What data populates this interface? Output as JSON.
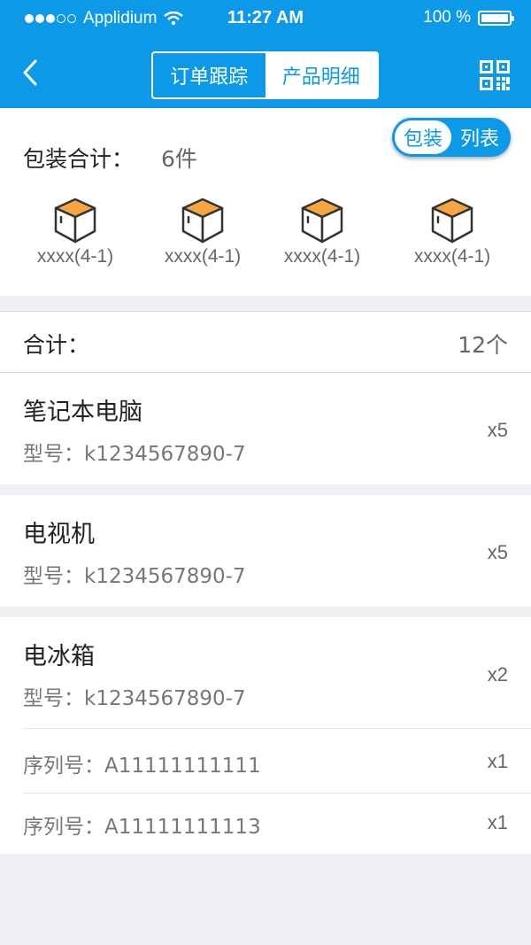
{
  "status_bar": {
    "carrier": "Applidium",
    "time": "11:27 AM",
    "battery": "100 %"
  },
  "nav": {
    "tabs": [
      {
        "label": "订单跟踪",
        "active": false
      },
      {
        "label": "产品明细",
        "active": true
      }
    ],
    "back_icon": "chevron-left-icon",
    "qr_icon": "qr-code-icon"
  },
  "packaging": {
    "label": "包装合计：",
    "count": "6件",
    "view_toggle": {
      "left": "包装",
      "right": "列表"
    },
    "boxes": [
      {
        "label": "xxxx(4-1)"
      },
      {
        "label": "xxxx(4-1)"
      },
      {
        "label": "xxxx(4-1)"
      },
      {
        "label": "xxxx(4-1)"
      }
    ]
  },
  "summary": {
    "label": "合计：",
    "value": "12个"
  },
  "products": [
    {
      "name": "笔记本电脑",
      "model": "型号：k1234567890-7",
      "qty": "x5"
    },
    {
      "name": "电视机",
      "model": "型号：k1234567890-7",
      "qty": "x5"
    },
    {
      "name": "电冰箱",
      "model": "型号：k1234567890-7",
      "qty": "x2",
      "serials": [
        {
          "label": "序列号：A11111111111",
          "qty": "x1"
        },
        {
          "label": "序列号：A11111111113",
          "qty": "x1"
        }
      ]
    }
  ],
  "colors": {
    "accent": "#0c9ae8",
    "box_top": "#f5a640",
    "background": "#efeff4"
  }
}
